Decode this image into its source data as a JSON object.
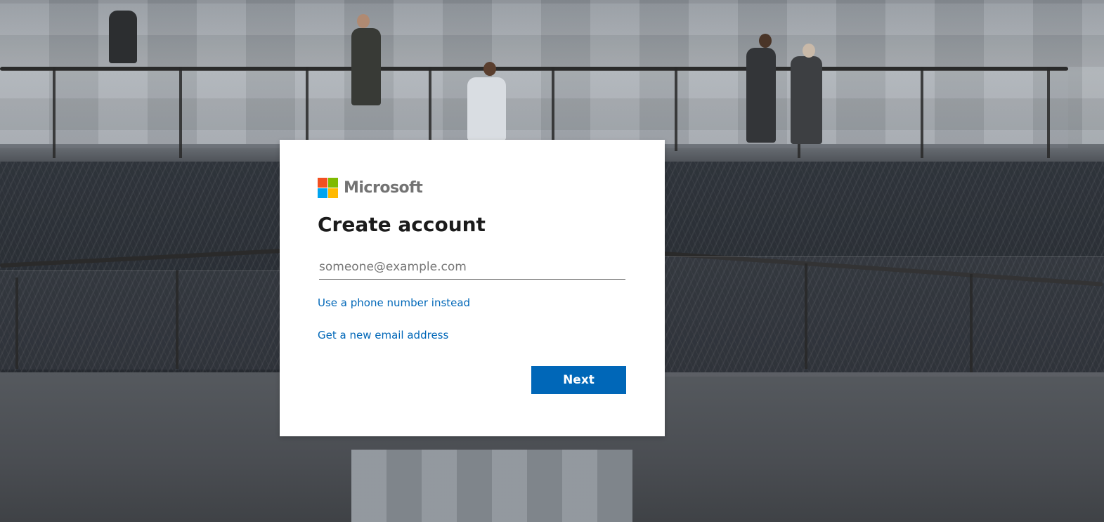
{
  "brand": {
    "name": "Microsoft",
    "logo_colors": [
      "#f25022",
      "#7fba00",
      "#00a4ef",
      "#ffb900"
    ]
  },
  "form": {
    "title": "Create account",
    "email_placeholder": "someone@example.com",
    "email_value": "",
    "phone_link_label": "Use a phone number instead",
    "new_email_link_label": "Get a new email address",
    "next_label": "Next"
  },
  "colors": {
    "accent": "#0067b8",
    "card_background": "#ffffff"
  }
}
